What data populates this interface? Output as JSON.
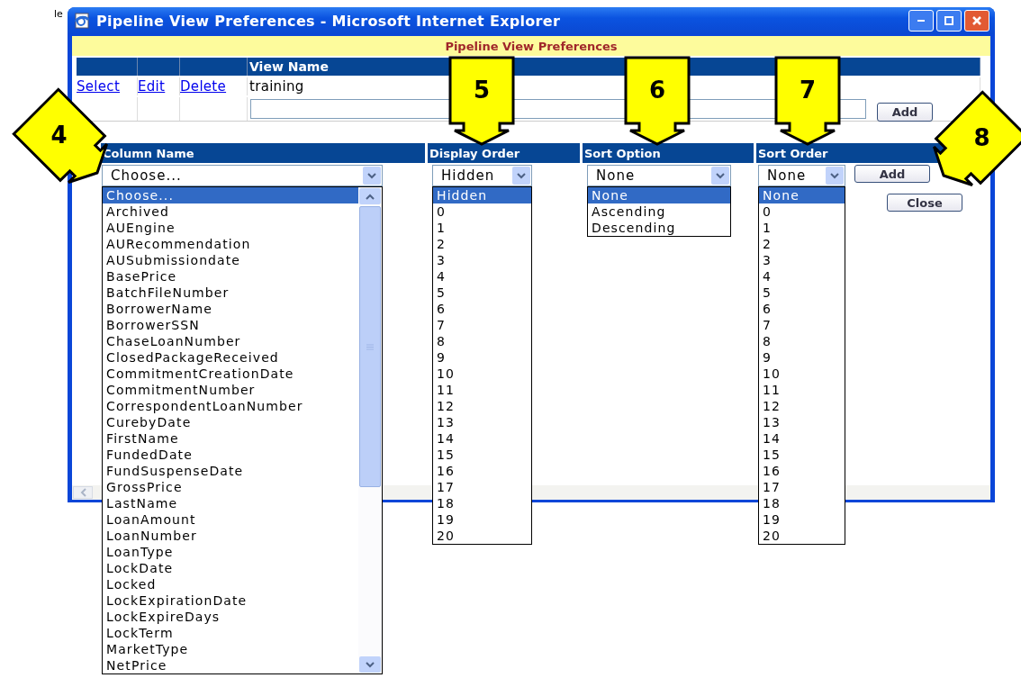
{
  "background_text": "le",
  "window": {
    "title": "Pipeline View Preferences - Microsoft Internet Explorer"
  },
  "page_title": "Pipeline View Preferences",
  "views_table": {
    "columns": [
      "View Name"
    ],
    "rows": [
      {
        "actions": [
          "Select",
          "Edit",
          "Delete"
        ],
        "view_name": "training"
      }
    ],
    "add_button": "Add"
  },
  "column_form": {
    "columns": [
      "Column Name",
      "Display Order",
      "Sort Option",
      "Sort Order"
    ],
    "selects": [
      {
        "value": "Choose...",
        "options": [
          {
            "label": "Choose...",
            "selected": true
          },
          {
            "label": "Archived",
            "selected": false
          },
          {
            "label": "AUEngine",
            "selected": false
          },
          {
            "label": "AURecommendation",
            "selected": false
          },
          {
            "label": "AUSubmissiondate",
            "selected": false
          },
          {
            "label": "BasePrice",
            "selected": false
          },
          {
            "label": "BatchFileNumber",
            "selected": false
          },
          {
            "label": "BorrowerName",
            "selected": false
          },
          {
            "label": "BorrowerSSN",
            "selected": false
          },
          {
            "label": "ChaseLoanNumber",
            "selected": false
          },
          {
            "label": "ClosedPackageReceived",
            "selected": false
          },
          {
            "label": "CommitmentCreationDate",
            "selected": false
          },
          {
            "label": "CommitmentNumber",
            "selected": false
          },
          {
            "label": "CorrespondentLoanNumber",
            "selected": false
          },
          {
            "label": "CurebyDate",
            "selected": false
          },
          {
            "label": "FirstName",
            "selected": false
          },
          {
            "label": "FundedDate",
            "selected": false
          },
          {
            "label": "FundSuspenseDate",
            "selected": false
          },
          {
            "label": "GrossPrice",
            "selected": false
          },
          {
            "label": "LastName",
            "selected": false
          },
          {
            "label": "LoanAmount",
            "selected": false
          },
          {
            "label": "LoanNumber",
            "selected": false
          },
          {
            "label": "LoanType",
            "selected": false
          },
          {
            "label": "LockDate",
            "selected": false
          },
          {
            "label": "Locked",
            "selected": false
          },
          {
            "label": "LockExpirationDate",
            "selected": false
          },
          {
            "label": "LockExpireDays",
            "selected": false
          },
          {
            "label": "LockTerm",
            "selected": false
          },
          {
            "label": "MarketType",
            "selected": false
          },
          {
            "label": "NetPrice",
            "selected": false
          }
        ]
      },
      {
        "value": "Hidden",
        "options": [
          {
            "label": "Hidden",
            "selected": true
          },
          {
            "label": "0",
            "selected": false
          },
          {
            "label": "1",
            "selected": false
          },
          {
            "label": "2",
            "selected": false
          },
          {
            "label": "3",
            "selected": false
          },
          {
            "label": "4",
            "selected": false
          },
          {
            "label": "5",
            "selected": false
          },
          {
            "label": "6",
            "selected": false
          },
          {
            "label": "7",
            "selected": false
          },
          {
            "label": "8",
            "selected": false
          },
          {
            "label": "9",
            "selected": false
          },
          {
            "label": "10",
            "selected": false
          },
          {
            "label": "11",
            "selected": false
          },
          {
            "label": "12",
            "selected": false
          },
          {
            "label": "13",
            "selected": false
          },
          {
            "label": "14",
            "selected": false
          },
          {
            "label": "15",
            "selected": false
          },
          {
            "label": "16",
            "selected": false
          },
          {
            "label": "17",
            "selected": false
          },
          {
            "label": "18",
            "selected": false
          },
          {
            "label": "19",
            "selected": false
          },
          {
            "label": "20",
            "selected": false
          }
        ]
      },
      {
        "value": "None",
        "options": [
          {
            "label": "None",
            "selected": true
          },
          {
            "label": "Ascending",
            "selected": false
          },
          {
            "label": "Descending",
            "selected": false
          }
        ]
      },
      {
        "value": "None",
        "options": [
          {
            "label": "None",
            "selected": true
          },
          {
            "label": "0",
            "selected": false
          },
          {
            "label": "1",
            "selected": false
          },
          {
            "label": "2",
            "selected": false
          },
          {
            "label": "3",
            "selected": false
          },
          {
            "label": "4",
            "selected": false
          },
          {
            "label": "5",
            "selected": false
          },
          {
            "label": "6",
            "selected": false
          },
          {
            "label": "7",
            "selected": false
          },
          {
            "label": "8",
            "selected": false
          },
          {
            "label": "9",
            "selected": false
          },
          {
            "label": "10",
            "selected": false
          },
          {
            "label": "11",
            "selected": false
          },
          {
            "label": "12",
            "selected": false
          },
          {
            "label": "13",
            "selected": false
          },
          {
            "label": "14",
            "selected": false
          },
          {
            "label": "15",
            "selected": false
          },
          {
            "label": "16",
            "selected": false
          },
          {
            "label": "17",
            "selected": false
          },
          {
            "label": "18",
            "selected": false
          },
          {
            "label": "19",
            "selected": false
          },
          {
            "label": "20",
            "selected": false
          }
        ]
      }
    ],
    "add_button": "Add",
    "close_button": "Close"
  },
  "callouts": [
    {
      "number": "4",
      "kind": "down-right"
    },
    {
      "number": "5",
      "kind": "down"
    },
    {
      "number": "6",
      "kind": "down"
    },
    {
      "number": "7",
      "kind": "down"
    },
    {
      "number": "8",
      "kind": "down-left"
    }
  ]
}
